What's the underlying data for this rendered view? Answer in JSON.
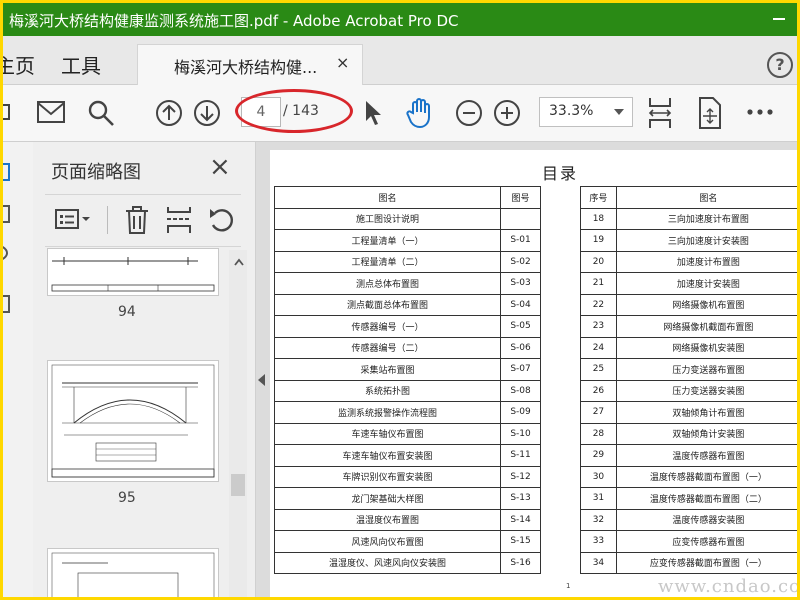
{
  "window": {
    "title": "梅溪河大桥结构健康监测系统施工图.pdf - Adobe Acrobat Pro DC"
  },
  "tabs": {
    "home_label": "主页",
    "tools_label": "工具",
    "document_tab_label": "梅溪河大桥结构健...",
    "close_glyph": "×",
    "help_glyph": "?"
  },
  "toolbar": {
    "current_page": "4",
    "total_pages": "/ 143",
    "zoom": "33.3%"
  },
  "thumbnail_panel": {
    "title": "页面缩略图",
    "close_glyph": "×",
    "pages": [
      {
        "number": "94"
      },
      {
        "number": "95"
      }
    ]
  },
  "document": {
    "heading": "目录",
    "left_table": {
      "headers": [
        "图名",
        "图号"
      ],
      "rows": [
        [
          "施工图设计说明",
          ""
        ],
        [
          "工程量清单（一）",
          "S-01"
        ],
        [
          "工程量清单（二）",
          "S-02"
        ],
        [
          "测点总体布置图",
          "S-03"
        ],
        [
          "测点截面总体布置图",
          "S-04"
        ],
        [
          "传感器编号（一）",
          "S-05"
        ],
        [
          "传感器编号（二）",
          "S-06"
        ],
        [
          "采集站布置图",
          "S-07"
        ],
        [
          "系统拓扑图",
          "S-08"
        ],
        [
          "监测系统报警操作流程图",
          "S-09"
        ],
        [
          "车速车轴仪布置图",
          "S-10"
        ],
        [
          "车速车轴仪布置安装图",
          "S-11"
        ],
        [
          "车牌识别仪布置安装图",
          "S-12"
        ],
        [
          "龙门架基础大样图",
          "S-13"
        ],
        [
          "温湿度仪布置图",
          "S-14"
        ],
        [
          "风速风向仪布置图",
          "S-15"
        ],
        [
          "温湿度仪、风速风向仪安装图",
          "S-16"
        ]
      ]
    },
    "right_table": {
      "headers": [
        "序号",
        "图名"
      ],
      "rows": [
        [
          "18",
          "三向加速度计布置图"
        ],
        [
          "19",
          "三向加速度计安装图"
        ],
        [
          "20",
          "加速度计布置图"
        ],
        [
          "21",
          "加速度计安装图"
        ],
        [
          "22",
          "网络摄像机布置图"
        ],
        [
          "23",
          "网络摄像机截面布置图"
        ],
        [
          "24",
          "网络摄像机安装图"
        ],
        [
          "25",
          "压力变送器布置图"
        ],
        [
          "26",
          "压力变送器安装图"
        ],
        [
          "27",
          "双轴倾角计布置图"
        ],
        [
          "28",
          "双轴倾角计安装图"
        ],
        [
          "29",
          "温度传感器布置图"
        ],
        [
          "30",
          "温度传感器截面布置图（一）"
        ],
        [
          "31",
          "温度传感器截面布置图（二）"
        ],
        [
          "32",
          "温度传感器安装图"
        ],
        [
          "33",
          "应变传感器布置图"
        ],
        [
          "34",
          "应变传感器截面布置图（一）"
        ]
      ]
    },
    "page_marker": "1",
    "watermark": "www.cndao.com"
  },
  "colors": {
    "title_bar": "#2a8a15",
    "highlight_oval": "#d8262b",
    "hand_tool": "#1a73c9",
    "border": "#ffd800"
  }
}
